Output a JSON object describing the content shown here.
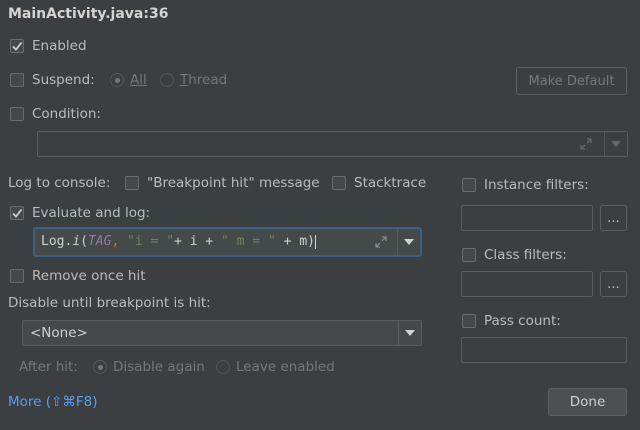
{
  "title": "MainActivity.java:36",
  "enabled_label": "Enabled",
  "suspend": {
    "label": "Suspend:",
    "all": "All",
    "thread_t": "T",
    "thread_rest": "hread",
    "make_default": "Make Default"
  },
  "condition_label": "Condition:",
  "log": {
    "label": "Log to console:",
    "breakpoint_hit": "\"Breakpoint hit\" message",
    "stacktrace": "Stacktrace"
  },
  "evaluate": {
    "label": "Evaluate and log:",
    "expr_a": "Log.",
    "expr_b": "i",
    "expr_c": "(",
    "expr_d": "TAG",
    "expr_e": ", ",
    "expr_f": "\"i = \"",
    "expr_g": "+ i + ",
    "expr_h": "\" m = \"",
    "expr_i": " + m)"
  },
  "remove_once_hit": "Remove once hit",
  "disable_until": {
    "label": "Disable until breakpoint is hit:",
    "value": "<None>"
  },
  "after_hit": {
    "label": "After hit:",
    "disable_again": "Disable again",
    "leave_enabled": "Leave enabled"
  },
  "right": {
    "instance_filters": "Instance filters:",
    "class_filters": "Class filters:",
    "pass_count": "Pass count:",
    "browse": "..."
  },
  "footer": {
    "more": "More (⇧⌘F8)",
    "done": "Done"
  },
  "colors": {
    "bg": "#3c3f41",
    "link": "#589df6",
    "focus": "#3d6185"
  }
}
